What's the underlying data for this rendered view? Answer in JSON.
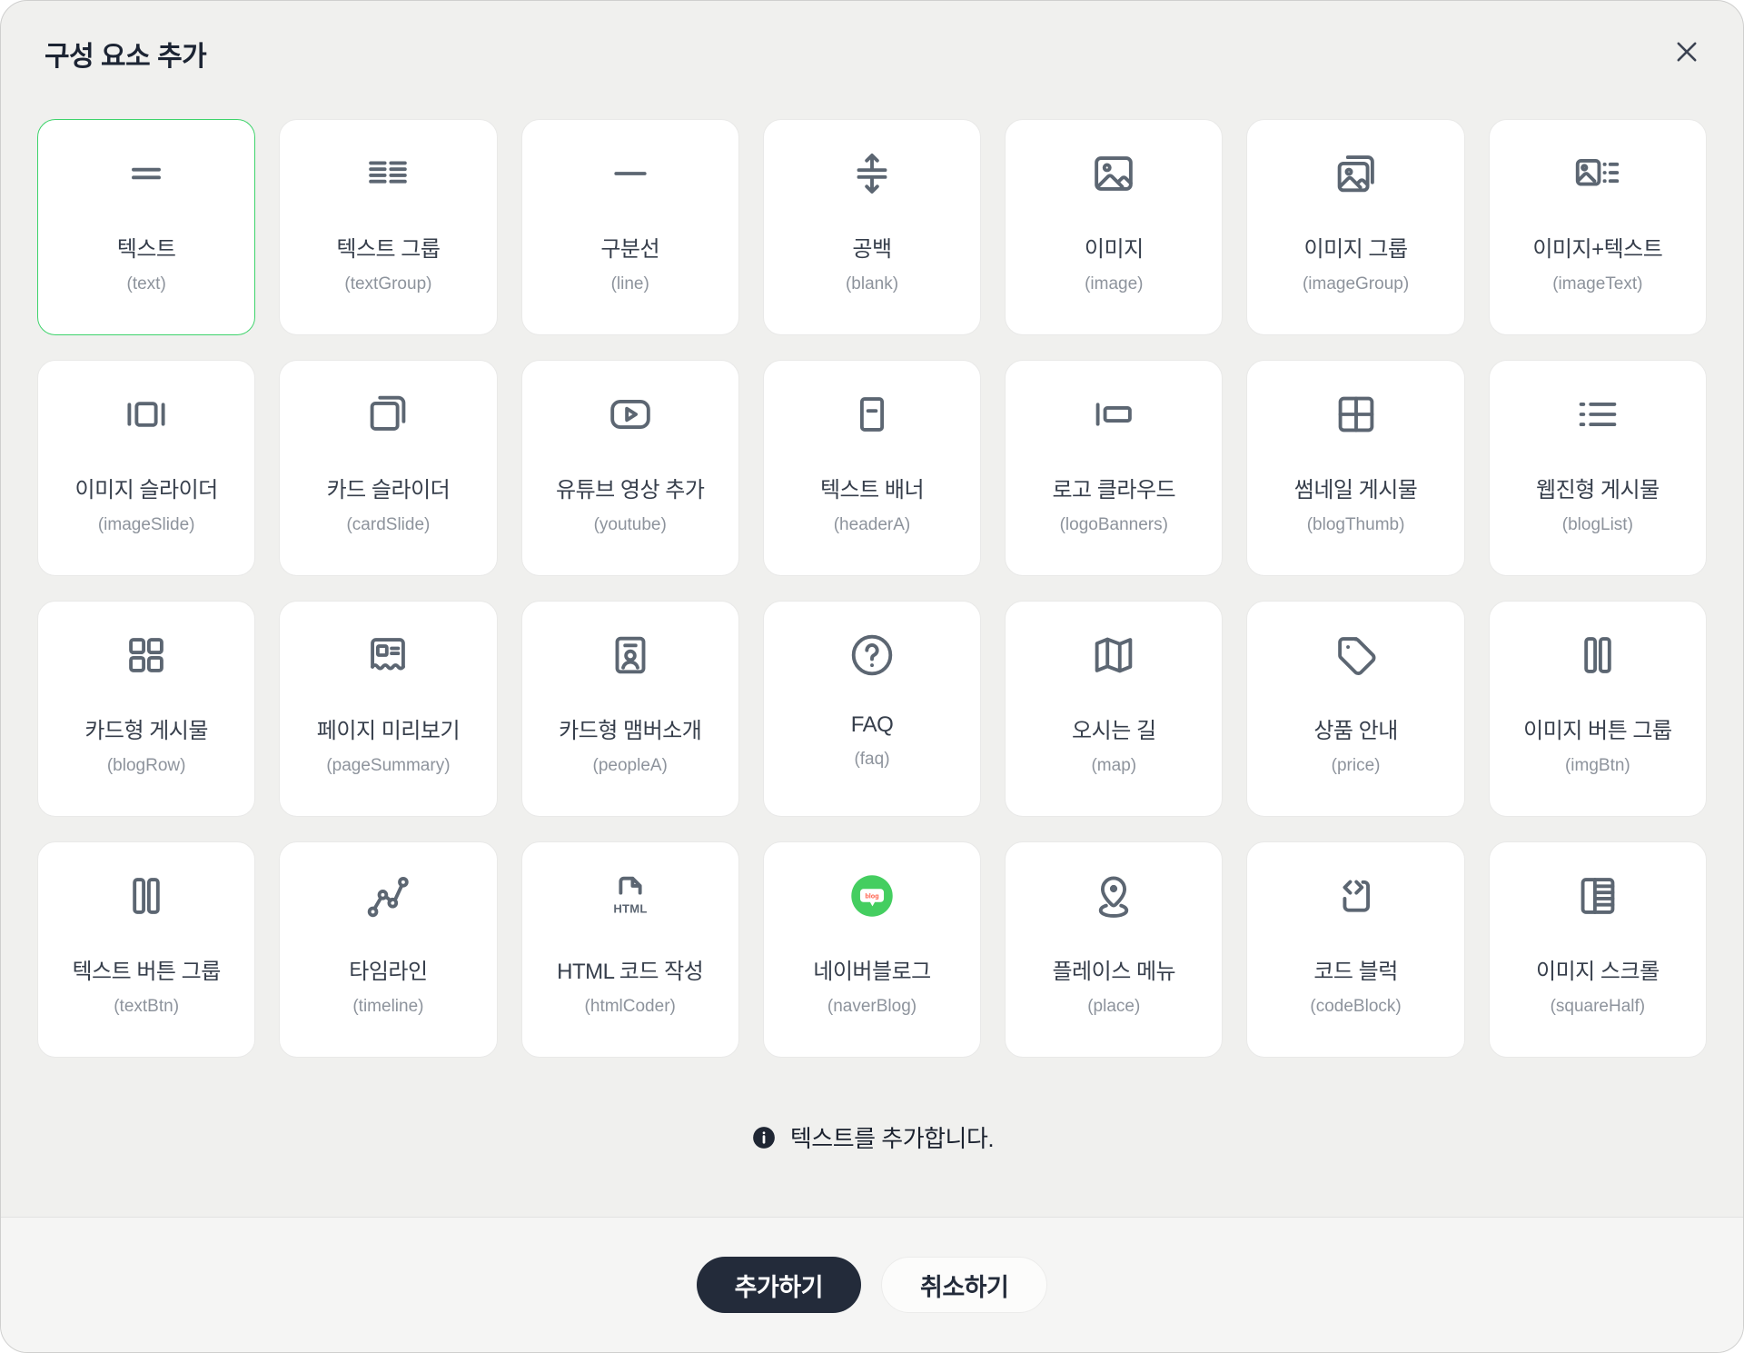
{
  "dialog": {
    "title": "구성 요소 추가",
    "info_message": "텍스트를 추가합니다.",
    "confirm_label": "추가하기",
    "cancel_label": "취소하기"
  },
  "colors": {
    "selected_border_green": "#3ed36b",
    "icon_gray": "#5c6672",
    "primary_button_dark": "#232b3a",
    "naver_green": "#44ce60",
    "blog_text_red": "#ff5f4a",
    "dialog_background": "#f0f0ee"
  },
  "selected_component": "text",
  "components": [
    {
      "label": "텍스트",
      "code": "text",
      "code_label": "(text)",
      "icon": "text-lines-icon"
    },
    {
      "label": "텍스트 그룹",
      "code": "textGroup",
      "code_label": "(textGroup)",
      "icon": "text-group-icon"
    },
    {
      "label": "구분선",
      "code": "line",
      "code_label": "(line)",
      "icon": "divider-line-icon"
    },
    {
      "label": "공백",
      "code": "blank",
      "code_label": "(blank)",
      "icon": "vertical-space-icon"
    },
    {
      "label": "이미지",
      "code": "image",
      "code_label": "(image)",
      "icon": "image-icon"
    },
    {
      "label": "이미지 그룹",
      "code": "imageGroup",
      "code_label": "(imageGroup)",
      "icon": "image-group-icon"
    },
    {
      "label": "이미지+텍스트",
      "code": "imageText",
      "code_label": "(imageText)",
      "icon": "image-text-icon"
    },
    {
      "label": "이미지 슬라이더",
      "code": "imageSlide",
      "code_label": "(imageSlide)",
      "icon": "image-slider-icon"
    },
    {
      "label": "카드 슬라이더",
      "code": "cardSlide",
      "code_label": "(cardSlide)",
      "icon": "card-slider-icon"
    },
    {
      "label": "유튜브 영상 추가",
      "code": "youtube",
      "code_label": "(youtube)",
      "icon": "youtube-play-icon"
    },
    {
      "label": "텍스트 배너",
      "code": "headerA",
      "code_label": "(headerA)",
      "icon": "text-banner-icon"
    },
    {
      "label": "로고 클라우드",
      "code": "logoBanners",
      "code_label": "(logoBanners)",
      "icon": "logo-cloud-icon"
    },
    {
      "label": "썸네일 게시물",
      "code": "blogThumb",
      "code_label": "(blogThumb)",
      "icon": "thumbnail-grid-icon"
    },
    {
      "label": "웹진형 게시물",
      "code": "blogList",
      "code_label": "(blogList)",
      "icon": "bullet-list-icon"
    },
    {
      "label": "카드형 게시물",
      "code": "blogRow",
      "code_label": "(blogRow)",
      "icon": "card-grid-icon"
    },
    {
      "label": "페이지 미리보기",
      "code": "pageSummary",
      "code_label": "(pageSummary)",
      "icon": "page-preview-icon"
    },
    {
      "label": "카드형 맴버소개",
      "code": "peopleA",
      "code_label": "(peopleA)",
      "icon": "member-card-icon"
    },
    {
      "label": "FAQ",
      "code": "faq",
      "code_label": "(faq)",
      "icon": "question-circle-icon"
    },
    {
      "label": "오시는 길",
      "code": "map",
      "code_label": "(map)",
      "icon": "map-icon"
    },
    {
      "label": "상품 안내",
      "code": "price",
      "code_label": "(price)",
      "icon": "price-tag-icon"
    },
    {
      "label": "이미지 버튼 그룹",
      "code": "imgBtn",
      "code_label": "(imgBtn)",
      "icon": "image-button-group-icon"
    },
    {
      "label": "텍스트 버튼 그룹",
      "code": "textBtn",
      "code_label": "(textBtn)",
      "icon": "text-button-group-icon"
    },
    {
      "label": "타임라인",
      "code": "timeline",
      "code_label": "(timeline)",
      "icon": "timeline-icon"
    },
    {
      "label": "HTML 코드 작성",
      "code": "htmlCoder",
      "code_label": "(htmlCoder)",
      "icon": "html-file-icon"
    },
    {
      "label": "네이버블로그",
      "code": "naverBlog",
      "code_label": "(naverBlog)",
      "icon": "naver-blog-icon"
    },
    {
      "label": "플레이스 메뉴",
      "code": "place",
      "code_label": "(place)",
      "icon": "place-pin-icon"
    },
    {
      "label": "코드 블럭",
      "code": "codeBlock",
      "code_label": "(codeBlock)",
      "icon": "code-block-icon"
    },
    {
      "label": "이미지 스크롤",
      "code": "squareHalf",
      "code_label": "(squareHalf)",
      "icon": "image-scroll-icon"
    }
  ]
}
